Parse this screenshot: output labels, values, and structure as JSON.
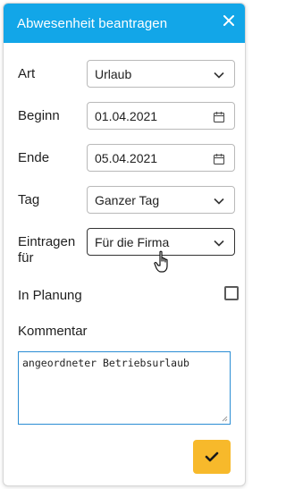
{
  "dialog": {
    "title": "Abwesenheit beantragen"
  },
  "form": {
    "art": {
      "label": "Art",
      "value": "Urlaub"
    },
    "beginn": {
      "label": "Beginn",
      "value": "01.04.2021"
    },
    "ende": {
      "label": "Ende",
      "value": "05.04.2021"
    },
    "tag": {
      "label": "Tag",
      "value": "Ganzer Tag"
    },
    "eintragen": {
      "label_line1": "Eintragen",
      "label_line2": "für",
      "value": "Für die Firma"
    },
    "in_planung": {
      "label": "In Planung",
      "checked": false
    },
    "kommentar": {
      "label": "Kommentar",
      "value": "angeordneter Betriebsurlaub"
    }
  },
  "colors": {
    "header": "#12a6e8",
    "confirm_button": "#f7b92b",
    "textarea_border": "#2a8dd4"
  },
  "icons": {
    "close": "close-icon",
    "dropdown": "chevron-down-icon",
    "date": "calendar-icon",
    "confirm": "checkmark-icon",
    "pointer": "hand-pointer-cursor"
  }
}
